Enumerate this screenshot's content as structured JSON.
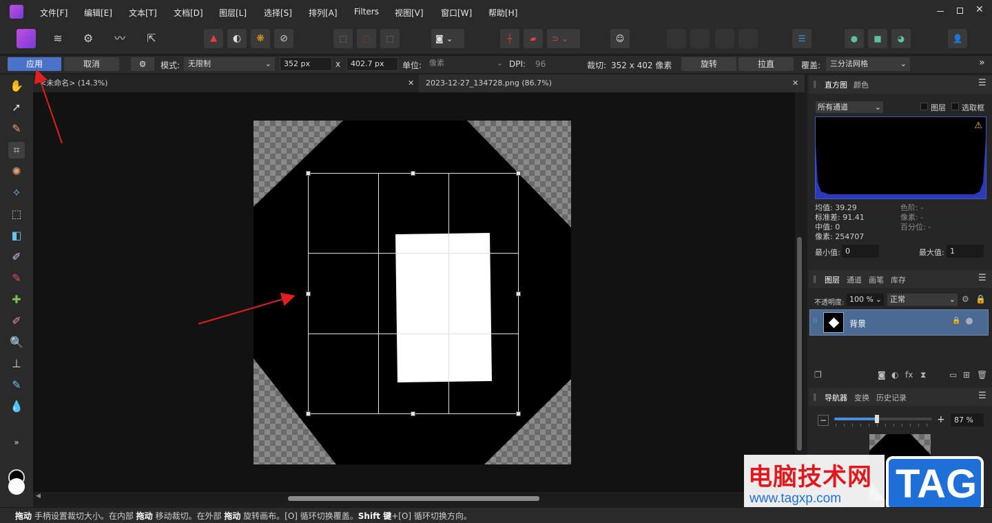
{
  "menu": {
    "items": [
      "文件[F]",
      "编辑[E]",
      "文本[T]",
      "文档[D]",
      "图层[L]",
      "选择[S]",
      "排列[A]",
      "Filters",
      "视图[V]",
      "窗口[W]",
      "帮助[H]"
    ]
  },
  "context_bar": {
    "apply_label": "应用",
    "cancel_label": "取消",
    "mode_label": "模式:",
    "mode_value": "无限制",
    "width_value": "352 px",
    "x_label": "x",
    "height_value": "402.7 px",
    "unit_label": "单位:",
    "unit_value": "像素",
    "dpi_label": "DPI:",
    "dpi_value": "96",
    "crop_label": "裁切:",
    "crop_value": "352 x 402 像素",
    "rotate_label": "旋转",
    "straighten_label": "拉直",
    "overlay_label": "覆盖:",
    "overlay_value": "三分法网格",
    "more_glyph": "»"
  },
  "tabs": [
    {
      "label": "<未命名> (14.3%)"
    },
    {
      "label": "2023-12-27_134728.png (86.7%)"
    }
  ],
  "histogram_panel": {
    "tab_histogram": "直方图",
    "tab_color": "颜色",
    "channel_value": "所有通道",
    "layer_check_label": "图层",
    "marquee_check_label": "选取框",
    "stats_left": [
      "均值: 39.29",
      "标准差: 91.41",
      "中值: 0",
      "像素: 254707"
    ],
    "stats_right": [
      "色阶: -",
      "像素: -",
      "百分位: -"
    ],
    "min_label": "最小值:",
    "min_value": "0",
    "max_label": "最大值:",
    "max_value": "1"
  },
  "layers_panel": {
    "tabs": [
      "图层",
      "通道",
      "画笔",
      "库存"
    ],
    "opacity_label": "不透明度:",
    "opacity_value": "100 %",
    "blend_value": "正常",
    "layer_name": "背景"
  },
  "navigator_panel": {
    "tabs": [
      "导航器",
      "变换",
      "历史记录"
    ],
    "zoom_percent": 87,
    "zoom_value": "87 %"
  },
  "status_bar": {
    "text_parts": [
      {
        "t": "拖动",
        "b": true
      },
      {
        "t": " 手柄设置裁切大小。在内部 ",
        "b": false
      },
      {
        "t": "拖动",
        "b": true
      },
      {
        "t": " 移动裁切。在外部 ",
        "b": false
      },
      {
        "t": "拖动",
        "b": true
      },
      {
        "t": " 旋转画布。[O] 循环切换覆盖。",
        "b": false
      },
      {
        "t": "Shift 键",
        "b": true
      },
      {
        "t": "+[O] 循环切换方向。",
        "b": false
      }
    ]
  },
  "watermark": {
    "site_name": "电脑技术网",
    "url": "www.tagxp.com",
    "badge": "TAG"
  },
  "colors": {
    "accent": "#3f6fc9",
    "apply_button": "#4a72c8",
    "layer_selected": "#4a6a94",
    "annotation_arrow": "#e02020",
    "watermark_red": "#e0191f",
    "watermark_blue": "#1f6fd8"
  }
}
